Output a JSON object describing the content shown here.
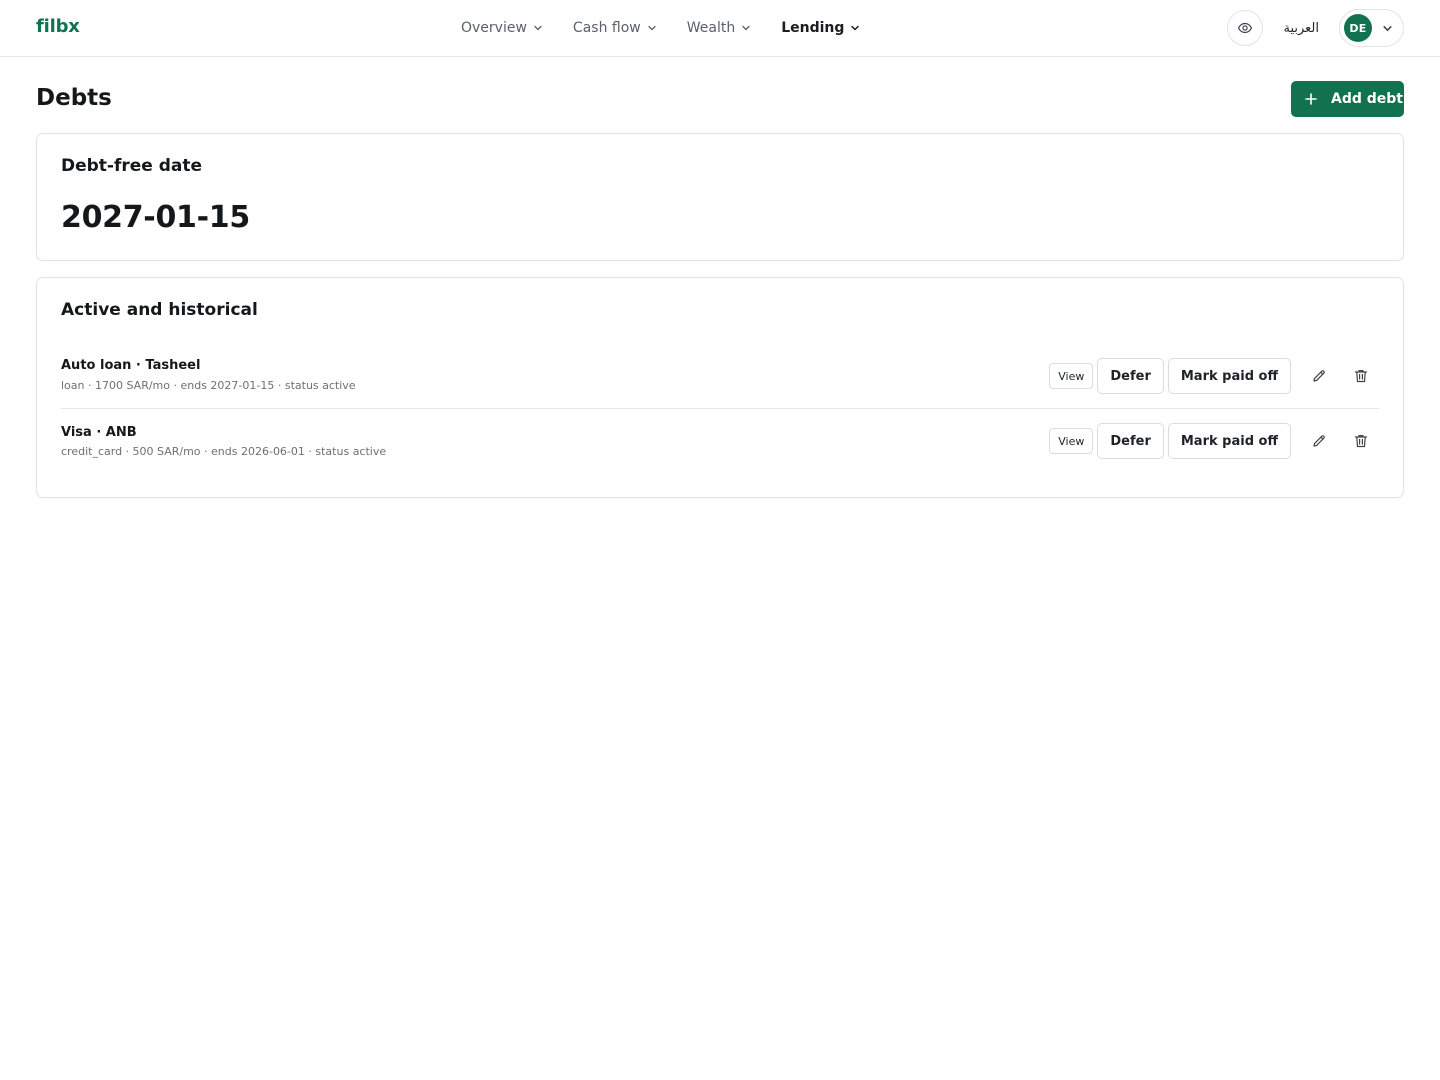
{
  "app": {
    "brand": "filbx"
  },
  "nav": {
    "items": [
      {
        "label": "Overview",
        "active": false
      },
      {
        "label": "Cash flow",
        "active": false
      },
      {
        "label": "Wealth",
        "active": false
      },
      {
        "label": "Lending",
        "active": true
      }
    ]
  },
  "header_tools": {
    "eye_icon": "eye-icon",
    "language_label": "العربية",
    "avatar_initials": "DE"
  },
  "page": {
    "title": "Debts",
    "add_button_label": "Add debt"
  },
  "debt_free": {
    "title": "Debt-free date",
    "value": "2027-01-15"
  },
  "debts": {
    "title": "Active and historical",
    "rows": [
      {
        "name": "Auto loan · Tasheel",
        "meta": "loan · 1700 SAR/mo · ends 2027-01-15 · status active",
        "view_label": "View",
        "defer_label": "Defer",
        "paid_off_label": "Mark paid off"
      },
      {
        "name": "Visa · ANB",
        "meta": "credit_card · 500 SAR/mo · ends 2026-06-01 · status active",
        "view_label": "View",
        "defer_label": "Defer",
        "paid_off_label": "Mark paid off"
      }
    ]
  },
  "colors": {
    "brand": "#12724f",
    "border": "#e3e3e3",
    "muted_text": "#6b7078"
  }
}
